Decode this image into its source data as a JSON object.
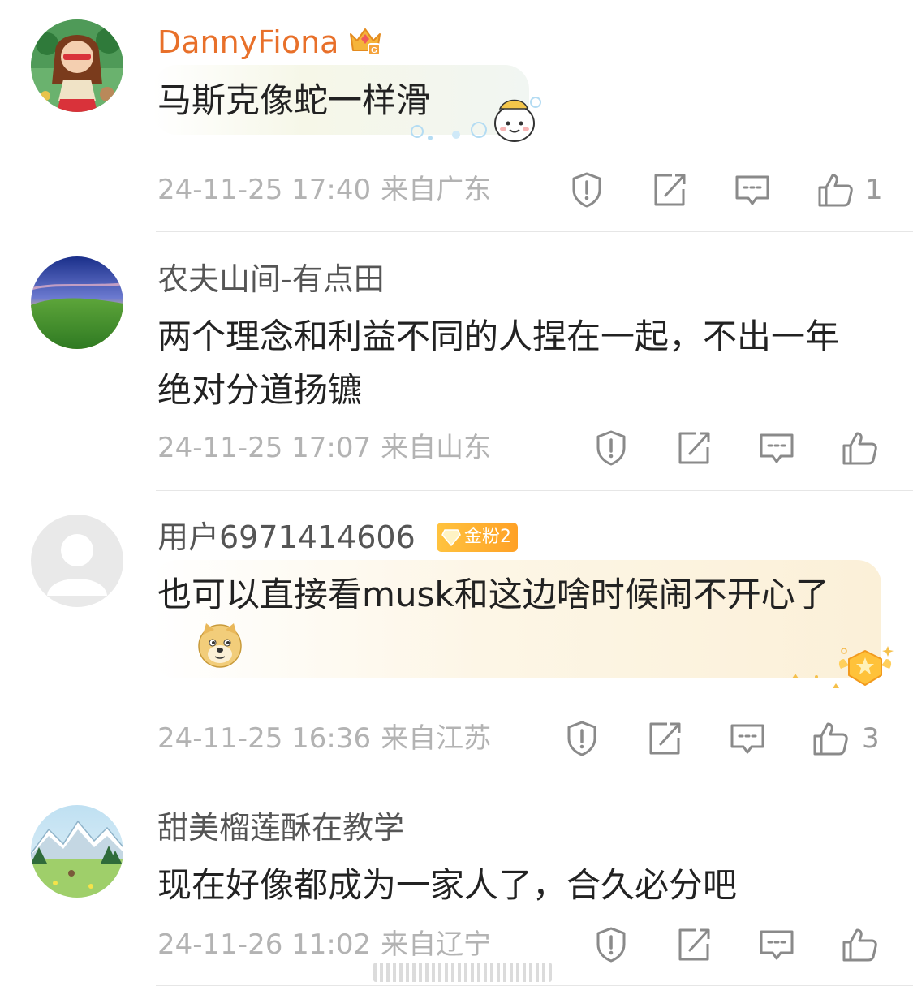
{
  "comments": [
    {
      "username": "DannyFiona",
      "text": "马斯克像蛇一样滑",
      "time": "24-11-25 17:40",
      "location": "来自广东",
      "likes": "1"
    },
    {
      "username": "农夫山间-有点田",
      "text": "两个理念和利益不同的人捏在一起，不出一年绝对分道扬镳",
      "time": "24-11-25 17:07",
      "location": "来自山东",
      "likes": ""
    },
    {
      "username": "用户6971414606",
      "badge": "金粉2",
      "text": "也可以直接看musk和这边啥时候闹不开心了",
      "time": "24-11-25 16:36",
      "location": "来自江苏",
      "likes": "3"
    },
    {
      "username": "甜美榴莲酥在教学",
      "text": "现在好像都成为一家人了，合久必分吧",
      "time": "24-11-26 11:02",
      "location": "来自辽宁",
      "likes": ""
    }
  ],
  "icons": {
    "report": "report-icon",
    "repost": "repost-icon",
    "reply": "comment-icon",
    "like": "thumbs-up-icon"
  },
  "colors": {
    "vip_name": "#e8702a",
    "meta_text": "#b3b3b3",
    "badge": "#ffb02e"
  }
}
